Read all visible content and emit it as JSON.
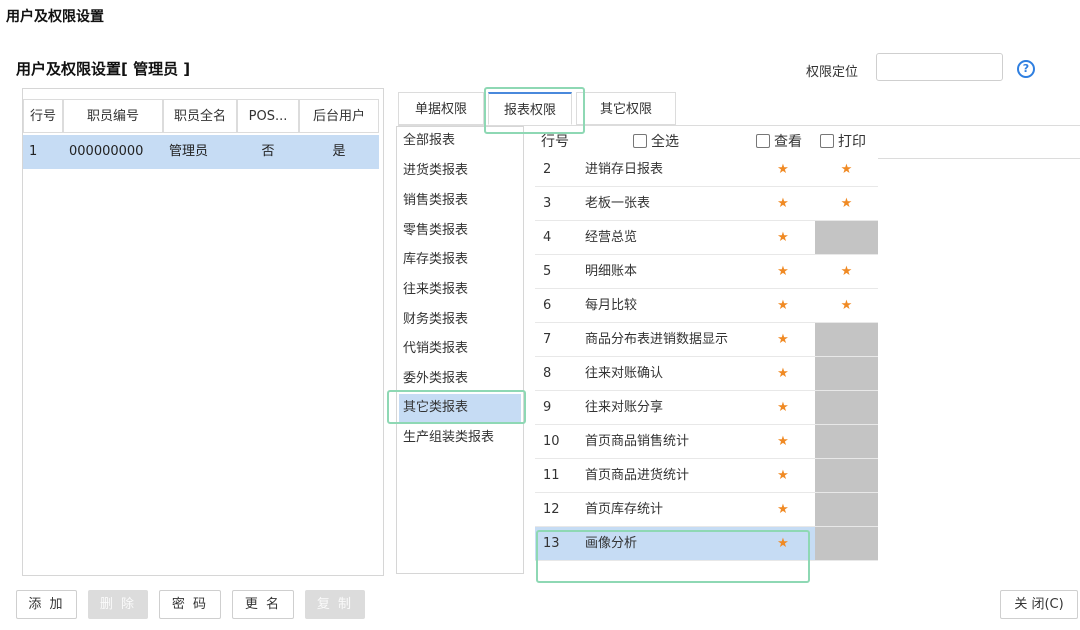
{
  "page_title": "用户及权限设置",
  "section_title": "用户及权限设置[ 管理员 ]",
  "locate": {
    "label": "权限定位",
    "value": ""
  },
  "help_icon_glyph": "?",
  "users": {
    "headers": [
      "行号",
      "职员编号",
      "职员全名",
      "POS...",
      "后台用户"
    ],
    "rows": [
      {
        "no": "1",
        "id": "000000000",
        "name": "管理员",
        "pos": "否",
        "backend": "是"
      }
    ]
  },
  "tabs": [
    "单据权限",
    "报表权限",
    "其它权限"
  ],
  "active_tab": "报表权限",
  "categories": [
    "全部报表",
    "进货类报表",
    "销售类报表",
    "零售类报表",
    "库存类报表",
    "往来类报表",
    "财务类报表",
    "代销类报表",
    "委外类报表",
    "其它类报表",
    "生产组装类报表"
  ],
  "selected_category": "其它类报表",
  "grid": {
    "headers": {
      "no": "行号",
      "select_all": "全选",
      "view": "查看",
      "print": "打印"
    },
    "rows": [
      {
        "no": "2",
        "name": "进销存日报表",
        "view": "★",
        "print": "★"
      },
      {
        "no": "3",
        "name": "老板一张表",
        "view": "★",
        "print": "★"
      },
      {
        "no": "4",
        "name": "经营总览",
        "view": "★",
        "print": ""
      },
      {
        "no": "5",
        "name": "明细账本",
        "view": "★",
        "print": "★"
      },
      {
        "no": "6",
        "name": "每月比较",
        "view": "★",
        "print": "★"
      },
      {
        "no": "7",
        "name": "商品分布表进销数据显示",
        "view": "★",
        "print": ""
      },
      {
        "no": "8",
        "name": "往来对账确认",
        "view": "★",
        "print": ""
      },
      {
        "no": "9",
        "name": "往来对账分享",
        "view": "★",
        "print": ""
      },
      {
        "no": "10",
        "name": "首页商品销售统计",
        "view": "★",
        "print": ""
      },
      {
        "no": "11",
        "name": "首页商品进货统计",
        "view": "★",
        "print": ""
      },
      {
        "no": "12",
        "name": "首页库存统计",
        "view": "★",
        "print": ""
      },
      {
        "no": "13",
        "name": "画像分析",
        "view": "★",
        "print": ""
      }
    ],
    "selected_row": "13"
  },
  "buttons": {
    "add": "添 加",
    "delete": "删 除",
    "password": "密 码",
    "rename": "更 名",
    "copy": "复 制",
    "close": "关 闭(C)"
  },
  "colors": {
    "accent": "#4a89dc",
    "selection": "#c6dcf4",
    "star": "#f08a24",
    "highlight": "#8ed8b4",
    "disabled_cell": "#c4c4c4"
  }
}
